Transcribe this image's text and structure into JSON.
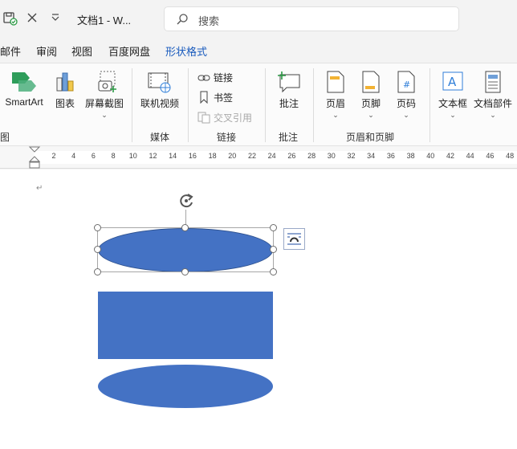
{
  "titlebar": {
    "doc_title": "文档1  -  W...",
    "search_placeholder": "搜索"
  },
  "tabs": [
    {
      "label": "邮件",
      "active": false
    },
    {
      "label": "审阅",
      "active": false
    },
    {
      "label": "视图",
      "active": false
    },
    {
      "label": "百度网盘",
      "active": false
    },
    {
      "label": "形状格式",
      "active": true
    }
  ],
  "ribbon": {
    "smartart": "SmartArt",
    "chart": "图表",
    "screenshot": "屏幕截图",
    "online_video": "联机视频",
    "link": "链接",
    "bookmark": "书签",
    "cross_ref": "交叉引用",
    "comment": "批注",
    "header": "页眉",
    "footer": "页脚",
    "page_number": "页码",
    "textbox": "文本框",
    "quick_parts": "文档部件",
    "groups": {
      "illustrations_tail": "图",
      "media": "媒体",
      "links": "链接",
      "comments": "批注",
      "header_footer": "页眉和页脚"
    }
  },
  "ruler": {
    "ticks": [
      "2",
      "4",
      "6",
      "8",
      "10",
      "12",
      "14",
      "16",
      "18",
      "20",
      "22",
      "24",
      "26",
      "28",
      "30",
      "32",
      "34",
      "36",
      "38",
      "40",
      "42",
      "44",
      "46",
      "48"
    ]
  },
  "document": {
    "paragraph_mark": "↵",
    "shape_color": "#4472c4"
  },
  "colors": {
    "accent": "#185abd"
  }
}
